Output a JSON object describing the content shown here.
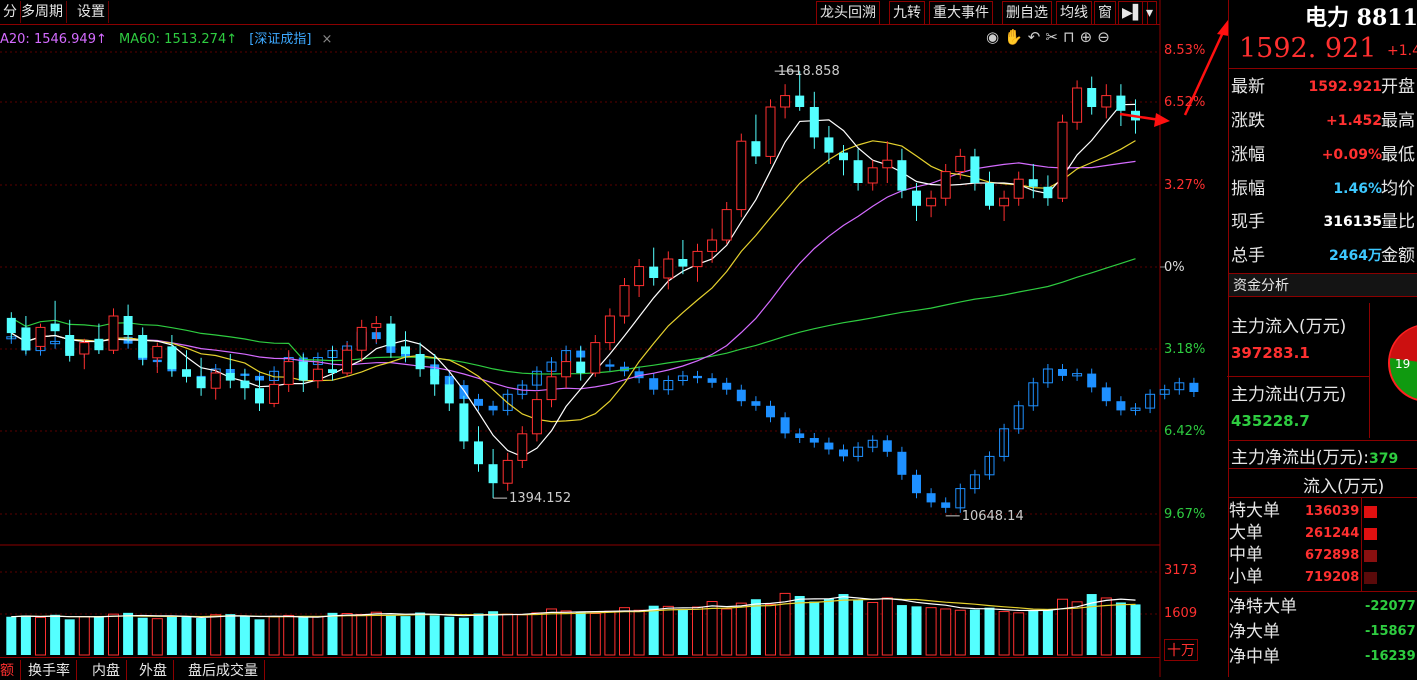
{
  "toolbar": {
    "left": [
      "分",
      "多周期",
      "设置"
    ],
    "right": [
      "龙头回溯",
      "九转",
      "重大事件",
      "删自选",
      "均线",
      "窗"
    ]
  },
  "ma_legend": {
    "ma20": "A20: 1546.949↑",
    "ma60": "MA60: 1513.274↑",
    "index": "[深证成指]",
    "close": "×"
  },
  "axis_pct_labels": [
    {
      "text": "8.53%",
      "color": "#ff3030"
    },
    {
      "text": "6.52%",
      "color": "#ff3030"
    },
    {
      "text": "3.27%",
      "color": "#ff3030"
    },
    {
      "text": "0%",
      "color": "#dddddd"
    },
    {
      "text": "3.18%",
      "color": "#2ecc40"
    },
    {
      "text": "6.42%",
      "color": "#2ecc40"
    },
    {
      "text": "9.67%",
      "color": "#2ecc40"
    }
  ],
  "vol_axis_labels": [
    "3173",
    "1609",
    "十万"
  ],
  "annotations": {
    "high": "1618.858",
    "low": "1394.152",
    "index_low": "10648.14"
  },
  "chart_data": {
    "type": "candlestick",
    "ohlc": [
      [
        1489,
        1492,
        1478,
        1481
      ],
      [
        1484,
        1490,
        1470,
        1472
      ],
      [
        1474,
        1486,
        1472,
        1484
      ],
      [
        1486,
        1498,
        1480,
        1482
      ],
      [
        1480,
        1488,
        1466,
        1469
      ],
      [
        1470,
        1478,
        1462,
        1476
      ],
      [
        1478,
        1486,
        1470,
        1472
      ],
      [
        1472,
        1494,
        1470,
        1490
      ],
      [
        1490,
        1496,
        1476,
        1480
      ],
      [
        1480,
        1484,
        1464,
        1468
      ],
      [
        1468,
        1476,
        1460,
        1474
      ],
      [
        1474,
        1480,
        1458,
        1462
      ],
      [
        1462,
        1472,
        1455,
        1458
      ],
      [
        1458,
        1468,
        1448,
        1452
      ],
      [
        1452,
        1462,
        1446,
        1460
      ],
      [
        1460,
        1470,
        1452,
        1456
      ],
      [
        1456,
        1462,
        1446,
        1452
      ],
      [
        1452,
        1458,
        1440,
        1444
      ],
      [
        1444,
        1456,
        1442,
        1454
      ],
      [
        1454,
        1472,
        1450,
        1466
      ],
      [
        1466,
        1470,
        1450,
        1456
      ],
      [
        1456,
        1466,
        1452,
        1462
      ],
      [
        1462,
        1474,
        1456,
        1460
      ],
      [
        1460,
        1476,
        1458,
        1472
      ],
      [
        1472,
        1488,
        1466,
        1484
      ],
      [
        1484,
        1490,
        1476,
        1486
      ],
      [
        1486,
        1490,
        1468,
        1474
      ],
      [
        1474,
        1482,
        1466,
        1470
      ],
      [
        1470,
        1476,
        1458,
        1462
      ],
      [
        1462,
        1470,
        1448,
        1454
      ],
      [
        1454,
        1458,
        1440,
        1444
      ],
      [
        1444,
        1448,
        1420,
        1424
      ],
      [
        1424,
        1432,
        1408,
        1412
      ],
      [
        1412,
        1420,
        1394.152,
        1402
      ],
      [
        1402,
        1418,
        1398,
        1414
      ],
      [
        1414,
        1432,
        1410,
        1428
      ],
      [
        1428,
        1450,
        1424,
        1446
      ],
      [
        1446,
        1462,
        1442,
        1458
      ],
      [
        1458,
        1470,
        1452,
        1466
      ],
      [
        1466,
        1474,
        1456,
        1460
      ],
      [
        1460,
        1480,
        1458,
        1476
      ],
      [
        1476,
        1494,
        1472,
        1490
      ],
      [
        1490,
        1510,
        1486,
        1506
      ],
      [
        1506,
        1520,
        1500,
        1516
      ],
      [
        1516,
        1526,
        1506,
        1510
      ],
      [
        1510,
        1524,
        1504,
        1520
      ],
      [
        1520,
        1530,
        1512,
        1516
      ],
      [
        1516,
        1528,
        1508,
        1524
      ],
      [
        1524,
        1536,
        1518,
        1530
      ],
      [
        1530,
        1550,
        1528,
        1546
      ],
      [
        1546,
        1586,
        1542,
        1582
      ],
      [
        1582,
        1596,
        1570,
        1574
      ],
      [
        1574,
        1604,
        1570,
        1600
      ],
      [
        1600,
        1612,
        1594,
        1606
      ],
      [
        1606,
        1618.858,
        1598,
        1600
      ],
      [
        1600,
        1608,
        1578,
        1584
      ],
      [
        1584,
        1590,
        1570,
        1576
      ],
      [
        1576,
        1580,
        1564,
        1572
      ],
      [
        1572,
        1578,
        1556,
        1560
      ],
      [
        1560,
        1572,
        1556,
        1568
      ],
      [
        1568,
        1582,
        1560,
        1572
      ],
      [
        1572,
        1578,
        1552,
        1556
      ],
      [
        1556,
        1560,
        1540,
        1548
      ],
      [
        1548,
        1556,
        1542,
        1552
      ],
      [
        1552,
        1570,
        1548,
        1566
      ],
      [
        1566,
        1578,
        1562,
        1574
      ],
      [
        1574,
        1578,
        1556,
        1560
      ],
      [
        1560,
        1566,
        1546,
        1548
      ],
      [
        1548,
        1556,
        1540,
        1552
      ],
      [
        1552,
        1566,
        1548,
        1562
      ],
      [
        1562,
        1570,
        1552,
        1558
      ],
      [
        1558,
        1564,
        1548,
        1552
      ],
      [
        1552,
        1596,
        1550,
        1592
      ],
      [
        1592,
        1614,
        1588,
        1610
      ],
      [
        1610,
        1616,
        1596,
        1600
      ],
      [
        1600,
        1612,
        1594,
        1606
      ],
      [
        1606,
        1612,
        1590,
        1598
      ],
      [
        1598,
        1604,
        1586,
        1592.921
      ]
    ],
    "index_series": [
      11020,
      10990,
      11005,
      11010,
      10985,
      11000,
      10995,
      11020,
      11005,
      10970,
      10965,
      10945,
      10935,
      10925,
      10950,
      10940,
      10935,
      10925,
      10945,
      10975,
      10960,
      10975,
      10990,
      11000,
      11030,
      11015,
      10985,
      10975,
      10960,
      10935,
      10915,
      10885,
      10870,
      10860,
      10895,
      10915,
      10945,
      10965,
      10990,
      10975,
      10960,
      10955,
      10945,
      10930,
      10905,
      10925,
      10935,
      10930,
      10920,
      10905,
      10880,
      10870,
      10845,
      10810,
      10800,
      10790,
      10775,
      10760,
      10780,
      10795,
      10770,
      10720,
      10680,
      10660,
      10648.14,
      10690,
      10720,
      10760,
      10820,
      10870,
      10920,
      10950,
      10935,
      10940,
      10910,
      10880,
      10860,
      10865,
      10895,
      10905,
      10920,
      10900
    ],
    "volume": [
      1180,
      1220,
      1160,
      1240,
      1100,
      1180,
      1200,
      1260,
      1300,
      1150,
      1120,
      1210,
      1180,
      1140,
      1240,
      1260,
      1200,
      1100,
      1180,
      1220,
      1160,
      1190,
      1300,
      1280,
      1250,
      1320,
      1240,
      1200,
      1310,
      1220,
      1180,
      1150,
      1280,
      1350,
      1260,
      1240,
      1300,
      1420,
      1360,
      1330,
      1280,
      1350,
      1460,
      1380,
      1520,
      1500,
      1420,
      1480,
      1650,
      1420,
      1600,
      1720,
      1560,
      1900,
      1820,
      1650,
      1740,
      1880,
      1700,
      1620,
      1760,
      1540,
      1500,
      1460,
      1420,
      1380,
      1400,
      1460,
      1340,
      1300,
      1360,
      1420,
      1720,
      1640,
      1880,
      1760,
      1620,
      1560
    ],
    "ma": {
      "MA20": 1546.949,
      "MA60": 1513.274
    },
    "ylim": [
      1380,
      1630
    ],
    "last_price": 1592.921
  },
  "quote": {
    "title": "电力 8811",
    "price": "1592. 921",
    "change_short": "+1.4",
    "rows": [
      {
        "label": "最新",
        "value": "1592.921",
        "right": "开盘",
        "color": "#ff3030"
      },
      {
        "label": "涨跌",
        "value": "+1.452",
        "right": "最高",
        "color": "#ff3030"
      },
      {
        "label": "涨幅",
        "value": "+0.09%",
        "right": "最低",
        "color": "#ff3030"
      },
      {
        "label": "振幅",
        "value": "1.46%",
        "right": "均价",
        "color": "#3dc8ff"
      },
      {
        "label": "现手",
        "value": "316135",
        "right": "量比",
        "color": "#ffffff"
      },
      {
        "label": "总手",
        "value": "2464万",
        "right": "金额",
        "color": "#3dc8ff"
      }
    ]
  },
  "capital": {
    "section": "资金分析",
    "inflow_label": "主力流入(万元)",
    "inflow_value": "397283.1",
    "outflow_label": "主力流出(万元)",
    "outflow_value": "435228.7",
    "net_label": "主力净流出(万元):",
    "net_value": "379",
    "pie_text": "19",
    "flow_header": "流入(万元)",
    "flows": [
      {
        "label": "特大单",
        "value": "136039"
      },
      {
        "label": "大单",
        "value": "261244"
      },
      {
        "label": "中单",
        "value": "672898"
      },
      {
        "label": "小单",
        "value": "719208"
      }
    ],
    "nets": [
      {
        "label": "净特大单",
        "value": "-22077"
      },
      {
        "label": "净大单",
        "value": "-15867"
      },
      {
        "label": "净中单",
        "value": "-16239"
      }
    ]
  },
  "bottom_tabs": [
    "额",
    "换手率",
    "内盘",
    "外盘",
    "盘后成交量"
  ]
}
